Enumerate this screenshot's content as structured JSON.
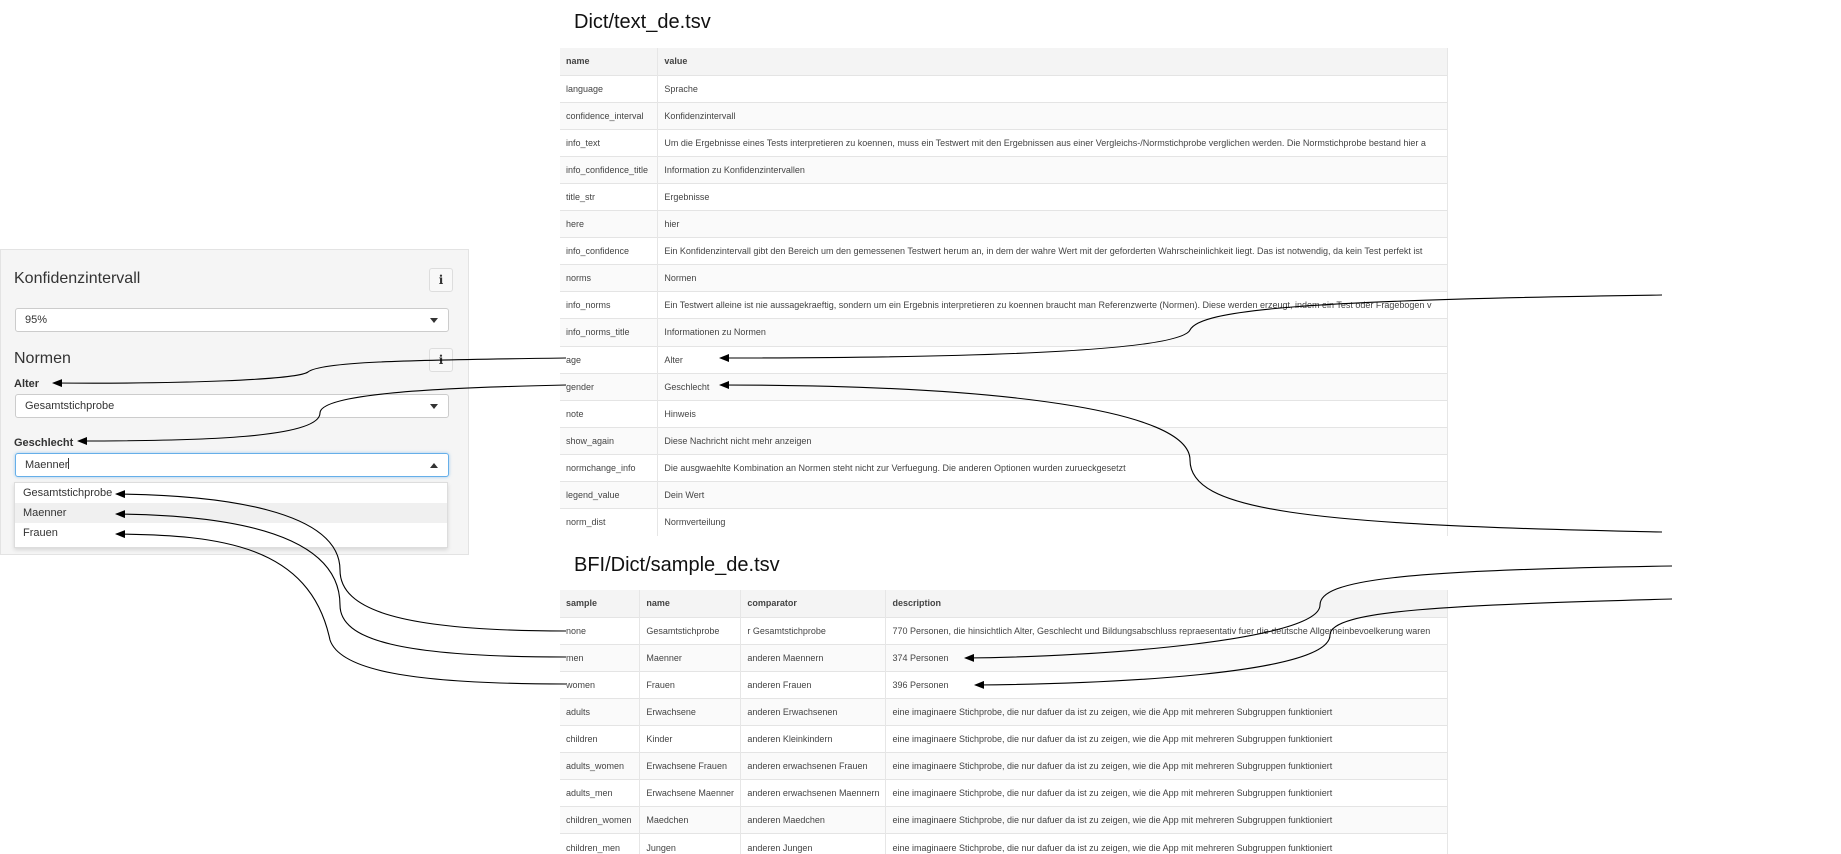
{
  "panel": {
    "confidence_title": "Konfidenzintervall",
    "confidence_info_icon": "i",
    "confidence_select_value": "95%",
    "norms_title": "Normen",
    "norms_info_icon": "i",
    "age_label": "Alter",
    "age_select_value": "Gesamtstichprobe",
    "gender_label": "Geschlecht",
    "gender_select_value": "Maenner",
    "gender_options": [
      "Gesamtstichprobe",
      "Maenner",
      "Frauen"
    ]
  },
  "table1": {
    "title": "Dict/text_de.tsv",
    "headers": [
      "name",
      "value"
    ],
    "rows": [
      [
        "language",
        "Sprache"
      ],
      [
        "confidence_interval",
        "Konfidenzintervall"
      ],
      [
        "info_text",
        "Um die Ergebnisse eines Tests interpretieren zu koennen, muss ein Testwert mit den Ergebnissen aus einer Vergleichs-/Normstichprobe verglichen werden. Die Normstichprobe bestand hier a"
      ],
      [
        "info_confidence_title",
        "Information zu Konfidenzintervallen"
      ],
      [
        "title_str",
        "Ergebnisse"
      ],
      [
        "here",
        "hier"
      ],
      [
        "info_confidence",
        "Ein Konfidenzintervall gibt den Bereich um den gemessenen Testwert herum an, in dem der wahre Wert mit der geforderten Wahrscheinlichkeit liegt. Das ist notwendig, da kein Test perfekt ist"
      ],
      [
        "norms",
        "Normen"
      ],
      [
        "info_norms",
        "Ein Testwert alleine ist nie aussagekraeftig, sondern um ein Ergebnis interpretieren zu koennen braucht man Referenzwerte (Normen). Diese werden erzeugt, indem ein Test oder Fragebogen v"
      ],
      [
        "info_norms_title",
        "Informationen zu Normen"
      ],
      [
        "age",
        "Alter"
      ],
      [
        "gender",
        "Geschlecht"
      ],
      [
        "note",
        "Hinweis"
      ],
      [
        "show_again",
        "Diese Nachricht nicht mehr anzeigen"
      ],
      [
        "normchange_info",
        "Die ausgwaehlte Kombination an Normen steht nicht zur Verfuegung. Die anderen Optionen wurden zurueckgesetzt"
      ],
      [
        "legend_value",
        "Dein Wert"
      ],
      [
        "norm_dist",
        "Normverteilung"
      ]
    ]
  },
  "table2": {
    "title": "BFI/Dict/sample_de.tsv",
    "headers": [
      "sample",
      "name",
      "comparator",
      "description"
    ],
    "rows": [
      [
        "none",
        "Gesamtstichprobe",
        "r Gesamtstichprobe",
        "770 Personen, die hinsichtlich Alter, Geschlecht und Bildungsabschluss repraesentativ fuer die deutsche Allgemeinbevoelkerung waren"
      ],
      [
        "men",
        "Maenner",
        "anderen Maennern",
        "374 Personen"
      ],
      [
        "women",
        "Frauen",
        "anderen Frauen",
        "396 Personen"
      ],
      [
        "adults",
        "Erwachsene",
        "anderen Erwachsenen",
        "eine imaginaere Stichprobe, die nur dafuer da ist zu zeigen, wie die App mit mehreren Subgruppen funktioniert"
      ],
      [
        "children",
        "Kinder",
        "anderen Kleinkindern",
        "eine imaginaere Stichprobe, die nur dafuer da ist zu zeigen, wie die App mit mehreren Subgruppen funktioniert"
      ],
      [
        "adults_women",
        "Erwachsene Frauen",
        "anderen erwachsenen Frauen",
        "eine imaginaere Stichprobe, die nur dafuer da ist zu zeigen, wie die App mit mehreren Subgruppen funktioniert"
      ],
      [
        "adults_men",
        "Erwachsene Maenner",
        "anderen erwachsenen Maennern",
        "eine imaginaere Stichprobe, die nur dafuer da ist zu zeigen, wie die App mit mehreren Subgruppen funktioniert"
      ],
      [
        "children_women",
        "Maedchen",
        "anderen Maedchen",
        "eine imaginaere Stichprobe, die nur dafuer da ist zu zeigen, wie die App mit mehreren Subgruppen funktioniert"
      ],
      [
        "children_men",
        "Jungen",
        "anderen Jungen",
        "eine imaginaere Stichprobe, die nur dafuer da ist zu zeigen, wie die App mit mehreren Subgruppen funktioniert"
      ]
    ]
  },
  "colors": {
    "arrow": "#000000",
    "focus_border": "#66afe9",
    "panel_bg": "#f5f5f5"
  }
}
